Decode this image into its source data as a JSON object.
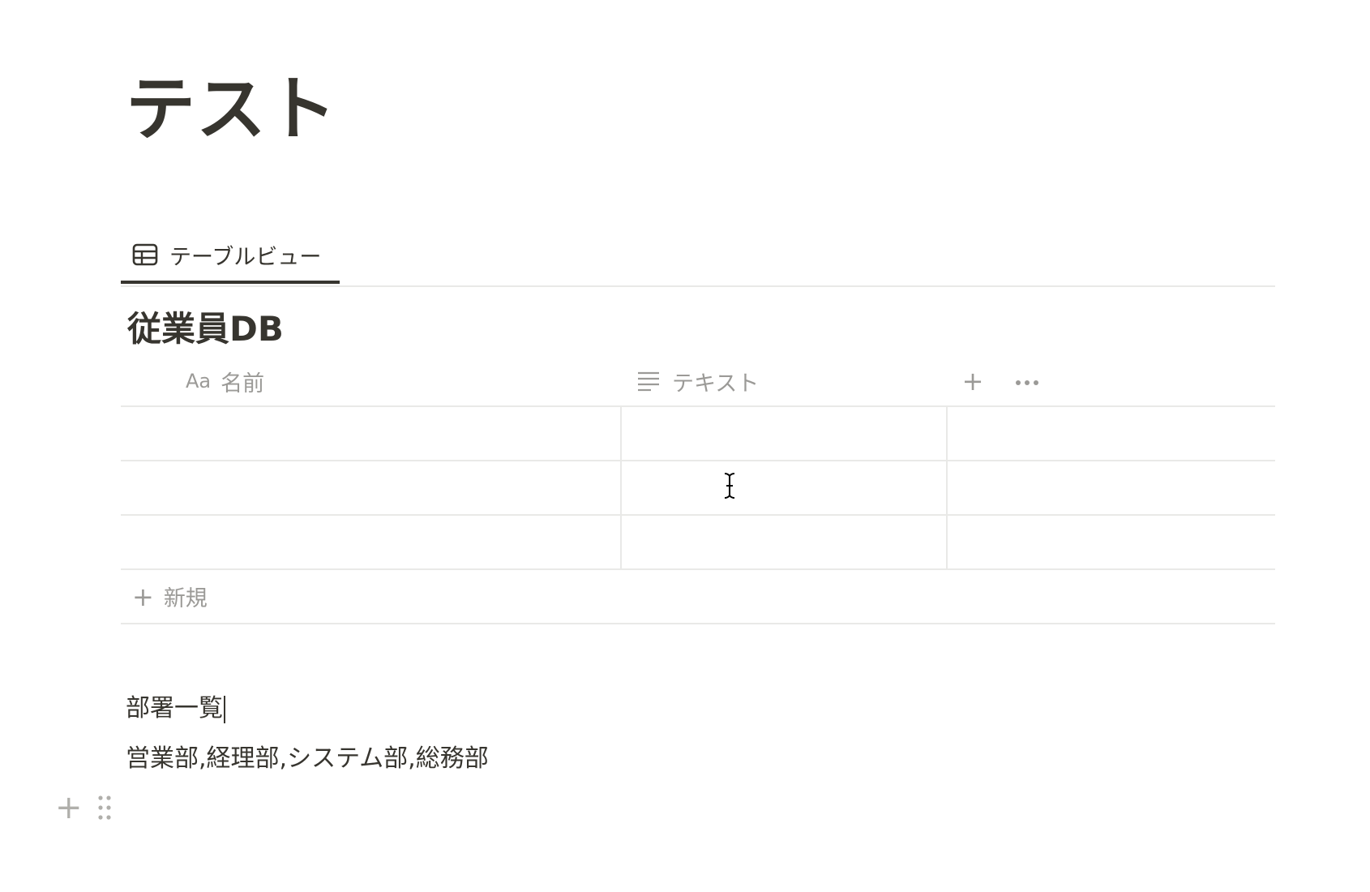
{
  "page": {
    "title": "テスト"
  },
  "view_tabs": [
    {
      "label": "テーブルビュー",
      "icon": "table-icon",
      "active": true
    }
  ],
  "database": {
    "title": "従業員DB",
    "columns": [
      {
        "label": "名前",
        "type_icon": "Aa"
      },
      {
        "label": "テキスト",
        "type_icon": "text-lines-icon"
      }
    ],
    "add_column_icon": "+",
    "more_icon": "ellipsis-icon",
    "rows": [
      {
        "name": "",
        "text": ""
      },
      {
        "name": "",
        "text": ""
      },
      {
        "name": "",
        "text": ""
      }
    ],
    "new_row_label": "新規",
    "new_row_icon": "+"
  },
  "paragraphs": [
    "部署一覧",
    "営業部,経理部,システム部,総務部"
  ],
  "block_controls": {
    "add_icon": "+",
    "drag_icon": "drag-handle-icon"
  }
}
